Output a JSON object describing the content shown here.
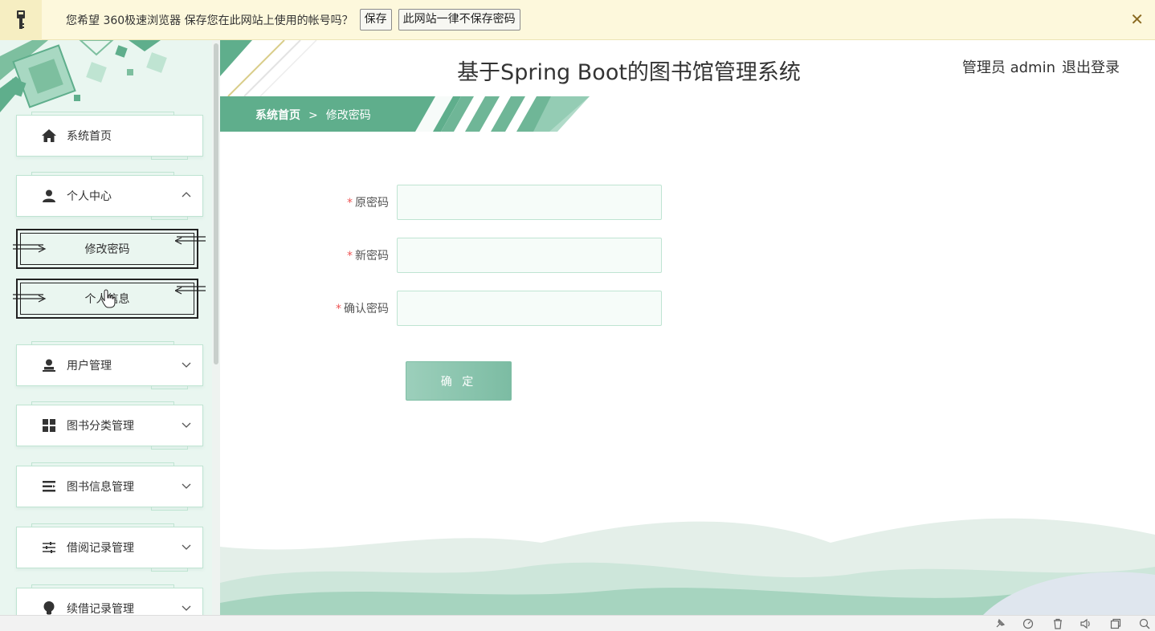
{
  "password_bar": {
    "message": "您希望 360极速浏览器 保存您在此网站上使用的帐号吗？",
    "save_label": "保存",
    "never_label": "此网站一律不保存密码",
    "close_label": "✕"
  },
  "sidebar": {
    "items": [
      {
        "label": "系统首页",
        "icon": "home-icon"
      },
      {
        "label": "个人中心",
        "icon": "user-icon",
        "expanded": true,
        "children": [
          {
            "label": "修改密码"
          },
          {
            "label": "个人信息"
          }
        ]
      },
      {
        "label": "用户管理",
        "icon": "user-stamp-icon"
      },
      {
        "label": "图书分类管理",
        "icon": "grid-icon"
      },
      {
        "label": "图书信息管理",
        "icon": "list-icon"
      },
      {
        "label": "借阅记录管理",
        "icon": "sliders-icon"
      },
      {
        "label": "续借记录管理",
        "icon": "bulb-icon"
      }
    ]
  },
  "header": {
    "title": "基于Spring Boot的图书馆管理系统",
    "user_label": "管理员 admin",
    "logout_label": "退出登录"
  },
  "breadcrumb": {
    "home": "系统首页",
    "separator": ">",
    "current": "修改密码"
  },
  "form": {
    "fields": [
      {
        "label": "原密码",
        "required_mark": "*",
        "value": ""
      },
      {
        "label": "新密码",
        "required_mark": "*",
        "value": ""
      },
      {
        "label": "确认密码",
        "required_mark": "*",
        "value": ""
      }
    ],
    "submit_label": "确 定"
  },
  "colors": {
    "accent": "#5fae8c",
    "accent_light": "#bfe4d2",
    "sidebar_bg": "#e9f6f0",
    "pw_bar_bg": "#fdf8dc"
  }
}
